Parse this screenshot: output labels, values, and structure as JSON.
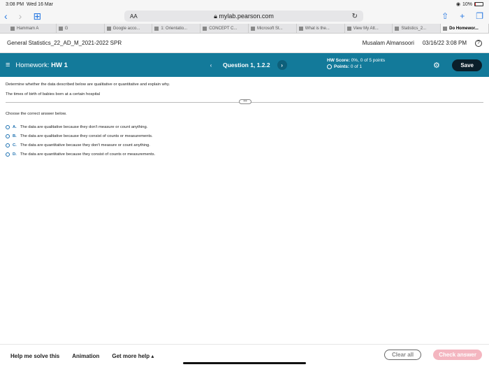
{
  "status": {
    "time": "3:08 PM",
    "date": "Wed 16 Mar",
    "battery": "10%"
  },
  "browser": {
    "aa_label": "AA",
    "url": "mylab.pearson.com",
    "tabs": [
      {
        "label": "Hammam A"
      },
      {
        "label": "G"
      },
      {
        "label": "Google acco..."
      },
      {
        "label": "1: Orientatio..."
      },
      {
        "label": "CONCEPT C..."
      },
      {
        "label": "Microsoft St..."
      },
      {
        "label": "What is the..."
      },
      {
        "label": "View My Att..."
      },
      {
        "label": "Statistics_2..."
      },
      {
        "label": "Do Homewor..."
      }
    ]
  },
  "course": {
    "name": "General Statistics_22_AD_M_2021-2022 SPR",
    "user": "Musalam Almansoori",
    "datetime": "03/16/22 3:08 PM",
    "help_glyph": "?"
  },
  "homework": {
    "label": "Homework:",
    "name": "HW 1",
    "question": "Question 1, 1.2.2",
    "hw_score_label": "HW Score:",
    "hw_score": "0%, 0 of 5 points",
    "points_label": "Points:",
    "points": "0 of 1",
    "save_label": "Save"
  },
  "question": {
    "instruction": "Determine whether the data described below are qualitative or quantitative and explain why.",
    "item": "The times of birth of babies born at a certain hospital",
    "prompt": "Choose the correct answer below.",
    "options": [
      {
        "letter": "A.",
        "text": "The data are qualitative because they don't measure or count anything."
      },
      {
        "letter": "B.",
        "text": "The data are qualitative because they consist of counts or measurements."
      },
      {
        "letter": "C.",
        "text": "The data are quantitative because they don't measure or count anything."
      },
      {
        "letter": "D.",
        "text": "The data are quantitative because they consist of counts or measurements."
      }
    ]
  },
  "footer": {
    "help_label": "Help me solve this",
    "animation_label": "Animation",
    "more_help_label": "Get more help ▴",
    "clear_label": "Clear all",
    "check_label": "Check answer"
  },
  "colors": {
    "header": "#137a9a",
    "accent": "#1a6fb0",
    "check": "#f4b6c0"
  }
}
